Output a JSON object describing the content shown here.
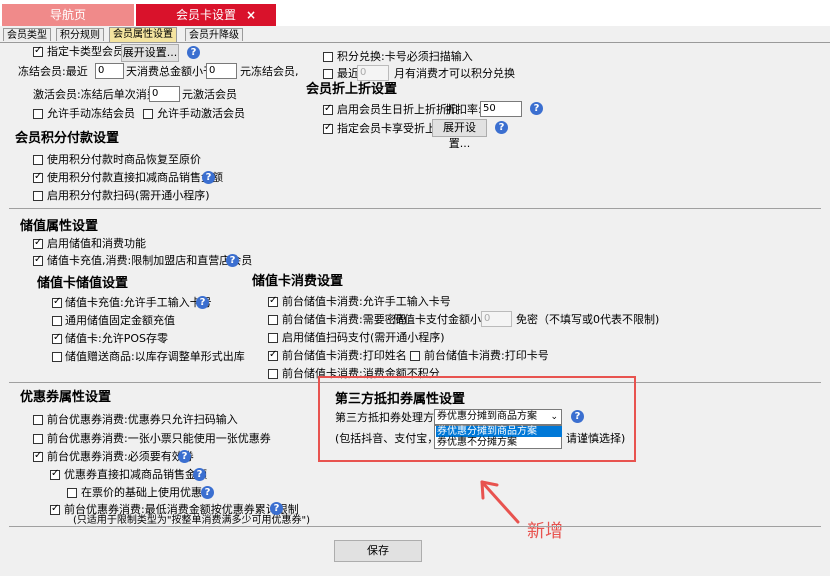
{
  "tabs": {
    "home": "导航页",
    "member_card": "会员卡设置",
    "close_icon": "×"
  },
  "subtabs": [
    "会员类型",
    "积分规则",
    "会员属性设置",
    "会员升降级"
  ],
  "top_section": {
    "card_type_member": "指定卡类型会员:",
    "expand_btn": "展开设置...",
    "freeze_prefix": "冻结会员:最近",
    "freeze_days": "0",
    "freeze_mid": "天消费总金额小于",
    "freeze_amount": "0",
    "freeze_suffix": "元冻结会员,",
    "activate_prefix": "激活会员:冻结后单次消费满",
    "activate_amount": "0",
    "activate_suffix": "元激活会员",
    "manual_freeze": "允许手动冻结会员",
    "manual_activate": "允许手动激活会员",
    "points_exchange_scan": "积分兑换:卡号必须扫描输入",
    "recent": "最近",
    "recent_months": "0",
    "recent_suffix": "月有消费才可以积分兑换"
  },
  "discount": {
    "title": "会员折上折设置",
    "birthday": "启用会员生日折上折折扣",
    "rate_label": "折扣率:",
    "rate_value": "50",
    "card_type": "指定会员卡享受折上折",
    "expand_btn": "展开设置..."
  },
  "points_pay": {
    "title": "会员积分付款设置",
    "opt1": "使用积分付款时商品恢复至原价",
    "opt2": "使用积分付款直接扣减商品销售金额",
    "opt3": "启用积分付款扫码(需开通小程序)"
  },
  "stored_value": {
    "title": "储值属性设置",
    "enable": "启用储值和消费功能",
    "restrict": "储值卡充值,消费:限制加盟店和直营店会员"
  },
  "sv_store": {
    "title": "储值卡储值设置",
    "opt1": "储值卡充值:允许手工输入卡号",
    "opt2": "通用储值固定金额充值",
    "opt3": "储值卡:允许POS存零",
    "opt4": "储值赠送商品:以库存调整单形式出库"
  },
  "sv_consume": {
    "title": "储值卡消费设置",
    "opt1": "前台储值卡消费:允许手工输入卡号",
    "opt2": "前台储值卡消费:需要密码",
    "pwd_limit_label": "储值卡支付金额小于",
    "pwd_limit_value": "0",
    "pwd_limit_suffix": "免密（不填写或0代表不限制)",
    "opt3": "启用储值扫码支付(需开通小程序)",
    "opt4": "前台储值卡消费:打印姓名",
    "opt4b": "前台储值卡消费:打印卡号",
    "opt5": "前台储值卡消费:消费金额不积分"
  },
  "coupon": {
    "title": "优惠券属性设置",
    "opt1": "前台优惠券消费:优惠券只允许扫码输入",
    "opt2": "前台优惠券消费:一张小票只能使用一张优惠券",
    "opt3": "前台优惠券消费:必须要有效券",
    "opt4": "优惠券直接扣减商品销售金额",
    "opt5": "在票价的基础上使用优惠券",
    "opt6": "前台优惠券消费:最低消费金额按优惠券累计限制",
    "opt6_note": "(只适用于限制类型为\"按整单消费满多少可用优惠券\")"
  },
  "third_party": {
    "title": "第三方抵扣券属性设置",
    "method_label": "第三方抵扣券处理方式:",
    "selected": "券优惠分摊到商品方案",
    "options": [
      "券优惠分摊到商品方案",
      "券优惠不分摊方案"
    ],
    "note_left": "(包括抖音、支付宝，涉及",
    "note_right": "请谨慎选择)"
  },
  "annotation": {
    "new_label": "新增",
    "color": "#e8534f"
  },
  "save_btn": "保存",
  "help_glyph": "?"
}
